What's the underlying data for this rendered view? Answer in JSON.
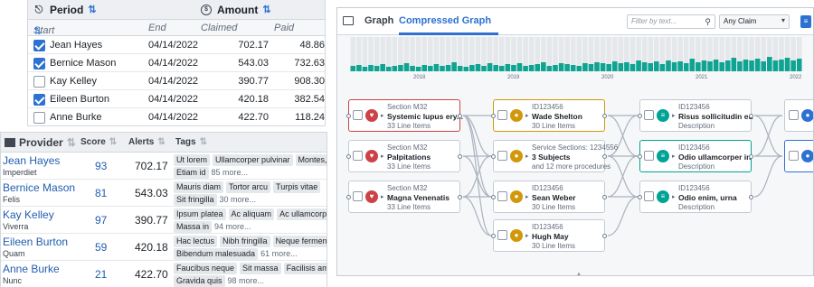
{
  "claims_table": {
    "group_period": "Period",
    "group_amount": "Amount",
    "columns": [
      "Start",
      "End",
      "Claimed",
      "Paid"
    ],
    "rows": [
      {
        "name": "Jean Hayes",
        "end": "04/14/2022",
        "claimed": "702.17",
        "paid": "48.86",
        "checked": true
      },
      {
        "name": "Bernice Mason",
        "end": "04/14/2022",
        "claimed": "543.03",
        "paid": "732.63",
        "checked": true
      },
      {
        "name": "Kay Kelley",
        "end": "04/14/2022",
        "claimed": "390.77",
        "paid": "908.30",
        "checked": false
      },
      {
        "name": "Eileen Burton",
        "end": "04/14/2022",
        "claimed": "420.18",
        "paid": "382.54",
        "checked": true
      },
      {
        "name": "Anne Burke",
        "end": "04/14/2022",
        "claimed": "422.70",
        "paid": "118.24",
        "checked": false
      }
    ]
  },
  "provider_table": {
    "col_provider": "Provider",
    "col_score": "Score",
    "col_alerts": "Alerts",
    "col_tags": "Tags",
    "rows": [
      {
        "name": "Jean Hayes",
        "sub": "Imperdiet",
        "score": "93",
        "alerts": "702.17",
        "tags1": [
          "Ut lorem",
          "Ullamcorper pulvinar",
          "Montes, moles"
        ],
        "tags2": [
          "Etiam id"
        ],
        "more": "85 more..."
      },
      {
        "name": "Bernice Mason",
        "sub": "Felis",
        "score": "81",
        "alerts": "543.03",
        "tags1": [
          "Mauris diam",
          "Tortor arcu",
          "Turpis vitae"
        ],
        "tags2": [
          "Sit fringilla"
        ],
        "more": "30 more..."
      },
      {
        "name": "Kay Kelley",
        "sub": "Viverra",
        "score": "97",
        "alerts": "390.77",
        "tags1": [
          "Ipsum platea",
          "Ac aliquam",
          "Ac ullamcorper"
        ],
        "tags2": [
          "Massa in"
        ],
        "more": "94 more..."
      },
      {
        "name": "Eileen Burton",
        "sub": "Quam",
        "score": "59",
        "alerts": "420.18",
        "tags1": [
          "Hac lectus",
          "Nibh fringilla",
          "Neque fermentum"
        ],
        "tags2": [
          "Bibendum malesuada"
        ],
        "more": "61 more..."
      },
      {
        "name": "Anne Burke",
        "sub": "Nunc",
        "score": "21",
        "alerts": "422.70",
        "tags1": [
          "Faucibus neque",
          "Sit massa",
          "Facilisis amet"
        ],
        "tags2": [
          "Gravida quis"
        ],
        "more": "98 more..."
      }
    ]
  },
  "graph_panel": {
    "tabs": [
      "Graph",
      "Compressed Graph"
    ],
    "active_tab": "Compressed Graph",
    "filter_placeholder": "Filter by text...",
    "claim_select": "Any Claim",
    "timeline_years": [
      "2018",
      "2019",
      "2020",
      "2021",
      "2022"
    ],
    "nodes": [
      {
        "l1": "Section M32",
        "l2": "Systemic lupus ery...",
        "l3": "33 Line Items",
        "icon": "heart-icon",
        "color": "#cd4246"
      },
      {
        "l1": "Section M32",
        "l2": "Palpitations",
        "l3": "33 Line Items",
        "icon": "heart-icon",
        "color": "#cd4246"
      },
      {
        "l1": "Section M32",
        "l2": "Magna Venenatis",
        "l3": "33 Line Items",
        "icon": "heart-icon",
        "color": "#cd4246"
      },
      {
        "l1": "ID123456",
        "l2": "Wade Shelton",
        "l3": "30 Line Items",
        "icon": "person-icon",
        "color": "#d1980b"
      },
      {
        "l1": "Service Sections: 1234556",
        "l2": "3 Subjects",
        "l3": "and 12 more procedures",
        "icon": "person-icon",
        "color": "#d1980b"
      },
      {
        "l1": "ID123456",
        "l2": "Sean Weber",
        "l3": "30 Line Items",
        "icon": "person-icon",
        "color": "#d1980b"
      },
      {
        "l1": "ID123456",
        "l2": "Hugh May",
        "l3": "30 Line Items",
        "icon": "person-icon",
        "color": "#d1980b"
      },
      {
        "l1": "ID123456",
        "l2": "Risus sollicitudin eu",
        "l3": "Description",
        "icon": "filter-icon",
        "color": "#00a396"
      },
      {
        "l1": "ID123456",
        "l2": "Odio ullamcorper in",
        "l3": "Description",
        "icon": "filter-icon",
        "color": "#00a396"
      },
      {
        "l1": "ID123456",
        "l2": "Odio enim, urna",
        "l3": "Description",
        "icon": "filter-icon",
        "color": "#00a396"
      }
    ]
  }
}
